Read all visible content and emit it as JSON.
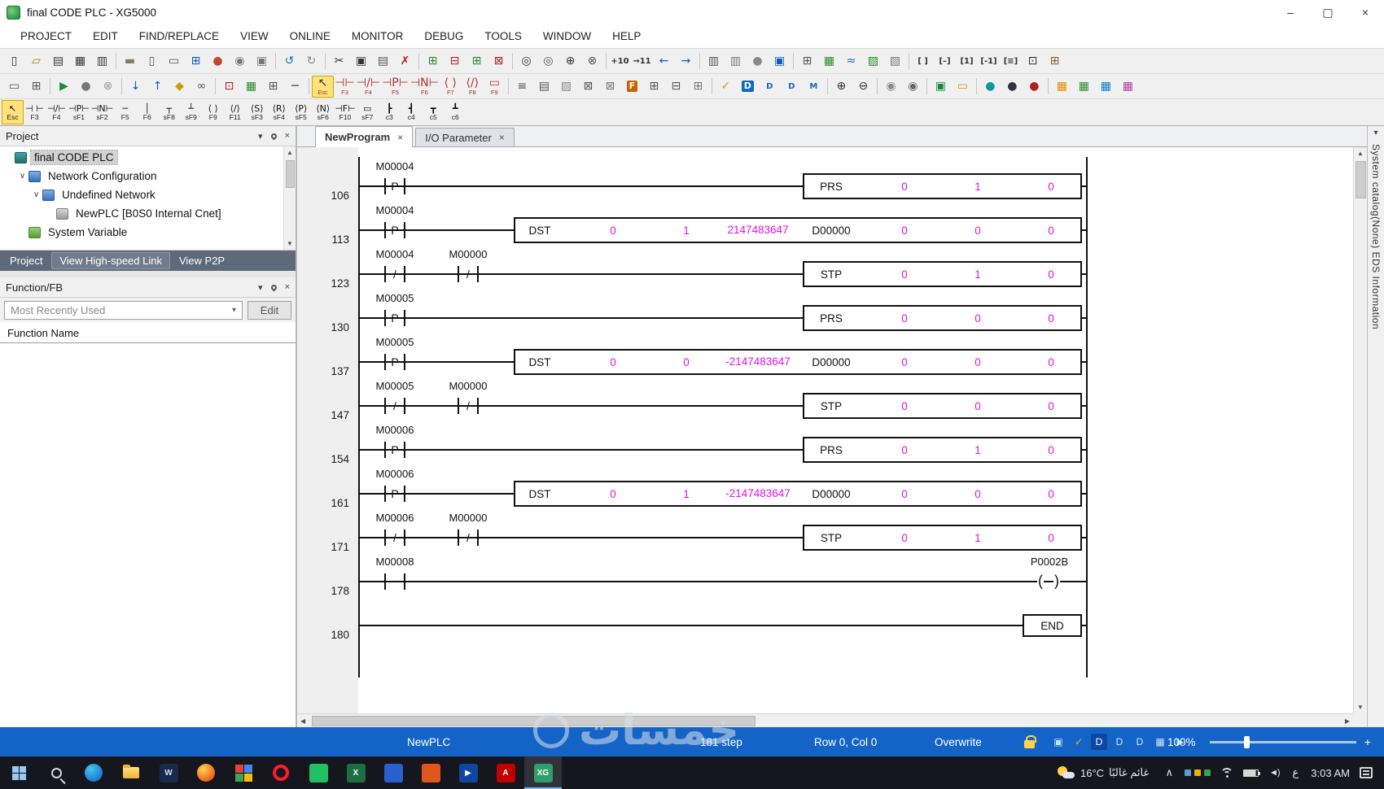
{
  "window": {
    "title": "final CODE PLC - XG5000",
    "controls": {
      "minimize": "–",
      "maximize": "▢",
      "close": "×"
    }
  },
  "glyphs": {
    "down": "▾",
    "expand": "∨",
    "scroll_up": "▲",
    "scroll_down": "▼",
    "scroll_left": "◀",
    "scroll_right": "▶"
  },
  "menu": {
    "items": [
      "PROJECT",
      "EDIT",
      "FIND/REPLACE",
      "VIEW",
      "ONLINE",
      "MONITOR",
      "DEBUG",
      "TOOLS",
      "WINDOW",
      "HELP"
    ]
  },
  "toolbar1": {
    "icons": [
      {
        "n": "new-file-icon",
        "g": "▯",
        "c": "#333"
      },
      {
        "n": "open-icon",
        "g": "▱",
        "c": "#a67c00"
      },
      {
        "n": "save-icon",
        "g": "▤",
        "c": "#333"
      },
      {
        "n": "save-all-icon",
        "g": "▦",
        "c": "#333"
      },
      {
        "n": "print-icon",
        "g": "▥",
        "c": "#333"
      },
      {
        "sep": true
      },
      {
        "n": "clipboard-icon",
        "g": "▬",
        "c": "#8a7a5a"
      },
      {
        "n": "print-preview-icon",
        "g": "▯",
        "c": "#555"
      },
      {
        "n": "page-setup-icon",
        "g": "▭",
        "c": "#555"
      },
      {
        "n": "grid-view-icon",
        "g": "⊞",
        "c": "#0a5ac8"
      },
      {
        "n": "monitor-ball-icon",
        "g": "●",
        "c": "#c04828"
      },
      {
        "n": "message-icon",
        "g": "◉",
        "c": "#777"
      },
      {
        "n": "capture-icon",
        "g": "▣",
        "c": "#777"
      },
      {
        "sep": true
      },
      {
        "n": "undo-icon",
        "g": "↺",
        "c": "#0a78b4"
      },
      {
        "n": "redo-icon",
        "g": "↻",
        "c": "#888"
      },
      {
        "sep": true
      },
      {
        "n": "cut-icon",
        "g": "✂",
        "c": "#333"
      },
      {
        "n": "copy-icon",
        "g": "▣",
        "c": "#333"
      },
      {
        "n": "paste-icon",
        "g": "▤",
        "c": "#555"
      },
      {
        "n": "delete-icon",
        "g": "✗",
        "c": "#c02020"
      },
      {
        "sep": true
      },
      {
        "n": "insert-line-icon",
        "g": "⊞",
        "c": "#2a8a2a"
      },
      {
        "n": "delete-line-icon",
        "g": "⊟",
        "c": "#c02020"
      },
      {
        "n": "insert-cell-icon",
        "g": "⊞",
        "c": "#2a8a2a"
      },
      {
        "n": "delete-cell-icon",
        "g": "⊠",
        "c": "#c02020"
      },
      {
        "sep": true
      },
      {
        "n": "find-icon",
        "g": "◎",
        "c": "#333"
      },
      {
        "n": "find-again-icon",
        "g": "◎",
        "c": "#555"
      },
      {
        "n": "replace-icon",
        "g": "⊕",
        "c": "#333"
      },
      {
        "n": "find-device-icon",
        "g": "⊗",
        "c": "#555"
      },
      {
        "sep": true
      },
      {
        "n": "goto-step-icon",
        "t": "+10",
        "c": "#333"
      },
      {
        "n": "goto-next-icon",
        "t": "→11",
        "c": "#333"
      },
      {
        "n": "back-icon",
        "g": "←",
        "c": "#0a5ac8"
      },
      {
        "n": "forward-icon",
        "g": "→",
        "c": "#0a5ac8"
      },
      {
        "sep": true
      },
      {
        "n": "print-ladder-icon",
        "g": "▥",
        "c": "#555"
      },
      {
        "n": "print-all-icon",
        "g": "▥",
        "c": "#777"
      },
      {
        "n": "user-icon",
        "g": "●",
        "c": "#888"
      },
      {
        "n": "options-icon",
        "g": "▣",
        "c": "#0a5ac8"
      },
      {
        "sep": true
      },
      {
        "n": "table-icon",
        "g": "⊞",
        "c": "#555"
      },
      {
        "n": "chart-icon",
        "g": "▦",
        "c": "#2a8a2a"
      },
      {
        "n": "trend-icon",
        "g": "≈",
        "c": "#0a78b4"
      },
      {
        "n": "graph-icon",
        "g": "▨",
        "c": "#2a8a2a"
      },
      {
        "n": "image-icon",
        "g": "▧",
        "c": "#777"
      },
      {
        "sep": true
      },
      {
        "n": "array-icon",
        "t": "[ ]",
        "c": "#333"
      },
      {
        "n": "array-minus-icon",
        "t": "[–]",
        "c": "#333"
      },
      {
        "n": "array-one-icon",
        "t": "[1]",
        "c": "#333"
      },
      {
        "n": "array-neg-icon",
        "t": "[-1]",
        "c": "#333"
      },
      {
        "n": "array-list-icon",
        "t": "[≡]",
        "c": "#333"
      },
      {
        "n": "struct-icon",
        "g": "⊡",
        "c": "#333"
      },
      {
        "n": "monitor-grid-icon",
        "g": "⊞",
        "c": "#965a28"
      }
    ]
  },
  "toolbar2": {
    "icons": [
      {
        "n": "window-icon",
        "g": "▭",
        "c": "#555"
      },
      {
        "n": "cascade-icon",
        "g": "⊞",
        "c": "#555"
      },
      {
        "sep": true
      },
      {
        "n": "run-icon",
        "g": "▶",
        "c": "#1a8a3a"
      },
      {
        "n": "pause-icon",
        "g": "●",
        "c": "#777"
      },
      {
        "n": "stop-icon",
        "g": "⊗",
        "c": "#999"
      },
      {
        "sep": true
      },
      {
        "n": "download-icon",
        "g": "↓",
        "c": "#0a5ac8"
      },
      {
        "n": "upload-icon",
        "g": "↑",
        "c": "#0a5ac8"
      },
      {
        "n": "key-icon",
        "g": "◆",
        "c": "#c8a000"
      },
      {
        "n": "link-icon",
        "g": "∞",
        "c": "#555"
      },
      {
        "sep": true
      },
      {
        "n": "online-edit-icon",
        "g": "⊡",
        "c": "#b02020"
      },
      {
        "n": "monitor-start-icon",
        "g": "▦",
        "c": "#2a8a2a"
      },
      {
        "n": "monitor-pause-icon",
        "g": "⊞",
        "c": "#555"
      },
      {
        "n": "hline-icon",
        "g": "─",
        "c": "#333"
      },
      {
        "sep": true
      },
      {
        "n": "select-tool",
        "g": "↖",
        "k": "Esc",
        "hl": true,
        "c": "#333"
      },
      {
        "n": "contact-tool",
        "g": "⊣⊢",
        "k": "F3",
        "c": "#b03030"
      },
      {
        "n": "nc-contact-tool",
        "g": "⊣/⊢",
        "k": "F4",
        "c": "#b03030"
      },
      {
        "n": "pulse-contact-tool",
        "g": "⊣P⊢",
        "k": "F5",
        "c": "#b03030"
      },
      {
        "n": "npulse-contact-tool",
        "g": "⊣N⊢",
        "k": "F6",
        "c": "#b03030"
      },
      {
        "n": "coil-tool",
        "g": "⟨ ⟩",
        "k": "F7",
        "c": "#b03030"
      },
      {
        "n": "nc-coil-tool",
        "g": "⟨/⟩",
        "k": "F8",
        "c": "#b03030"
      },
      {
        "n": "fb-tool",
        "g": "▭",
        "k": "F9",
        "c": "#b03030"
      },
      {
        "sep": true
      },
      {
        "n": "list-icon",
        "g": "≡",
        "c": "#555"
      },
      {
        "n": "comment-icon",
        "g": "▤",
        "c": "#555"
      },
      {
        "n": "image2-icon",
        "g": "▨",
        "c": "#888"
      },
      {
        "n": "cross-ref-icon",
        "g": "⊠",
        "c": "#555"
      },
      {
        "n": "used-device-icon",
        "g": "⊠",
        "c": "#777"
      },
      {
        "n": "font-icon",
        "t": "F",
        "c": "#fff",
        "bg": "#c86400"
      },
      {
        "n": "grid2-icon",
        "g": "⊞",
        "c": "#555"
      },
      {
        "n": "grid3-icon",
        "g": "⊟",
        "c": "#555"
      },
      {
        "n": "grid4-icon",
        "g": "⊞",
        "c": "#777"
      },
      {
        "sep": true
      },
      {
        "n": "check-program-icon",
        "g": "✓",
        "c": "#e88a00"
      },
      {
        "n": "device1-icon",
        "t": "D",
        "c": "#fff",
        "bg": "#1469be"
      },
      {
        "n": "device2-icon",
        "t": "D",
        "c": "#1469be"
      },
      {
        "n": "device3-icon",
        "t": "D",
        "c": "#1469be"
      },
      {
        "n": "memory-icon",
        "t": "M",
        "c": "#1469be"
      },
      {
        "sep": true
      },
      {
        "n": "zoom-in-icon",
        "g": "⊕",
        "c": "#333"
      },
      {
        "n": "zoom-out-icon",
        "g": "⊖",
        "c": "#333"
      },
      {
        "sep": true
      },
      {
        "n": "user1-icon",
        "g": "◉",
        "c": "#888"
      },
      {
        "n": "user2-icon",
        "g": "◉",
        "c": "#666"
      },
      {
        "sep": true
      },
      {
        "n": "screen-icon",
        "g": "▣",
        "c": "#1a8a3a"
      },
      {
        "n": "note-icon",
        "g": "▭",
        "c": "#c8a000"
      },
      {
        "sep": true
      },
      {
        "n": "circle1-icon",
        "g": "●",
        "c": "#0a9a9a"
      },
      {
        "n": "circle2-icon",
        "g": "●",
        "c": "#333344"
      },
      {
        "n": "circle3-icon",
        "g": "●",
        "c": "#b02020"
      },
      {
        "sep": true
      },
      {
        "n": "mod1-icon",
        "g": "▦",
        "c": "#e88a00"
      },
      {
        "n": "mod2-icon",
        "g": "▦",
        "c": "#2a8a2a"
      },
      {
        "n": "mod3-icon",
        "g": "▦",
        "c": "#0a78c8"
      },
      {
        "n": "mod4-icon",
        "g": "▦",
        "c": "#b23ab2"
      }
    ]
  },
  "ladder_tools": {
    "items": [
      {
        "s": "↖",
        "k": "Esc",
        "sel": true
      },
      {
        "s": "⊣ ⊢",
        "k": "F3"
      },
      {
        "s": "⊣/⊢",
        "k": "F4"
      },
      {
        "s": "⊣P⊢",
        "k": "sF1"
      },
      {
        "s": "⊣N⊢",
        "k": "sF2"
      },
      {
        "s": "─",
        "k": "F5"
      },
      {
        "s": "│",
        "k": "F6"
      },
      {
        "s": "┬",
        "k": "sF8"
      },
      {
        "s": "┴",
        "k": "sF9"
      },
      {
        "s": "⟨ ⟩",
        "k": "F9"
      },
      {
        "s": "⟨/⟩",
        "k": "F11"
      },
      {
        "s": "⟨S⟩",
        "k": "sF3"
      },
      {
        "s": "⟨R⟩",
        "k": "sF4"
      },
      {
        "s": "⟨P⟩",
        "k": "sF5"
      },
      {
        "s": "⟨N⟩",
        "k": "sF6"
      },
      {
        "s": "⊣F⊢",
        "k": "F10"
      },
      {
        "s": "▭",
        "k": "sF7"
      },
      {
        "s": "┣",
        "k": "c3"
      },
      {
        "s": "┫",
        "k": "c4"
      },
      {
        "s": "┳",
        "k": "c5"
      },
      {
        "s": "┻",
        "k": "c6"
      }
    ]
  },
  "panel_header_icons": [
    {
      "name": "collapse-icon",
      "glyph": "▾"
    },
    {
      "name": "pin-icon",
      "glyph": "pin"
    },
    {
      "name": "close-icon",
      "glyph": "×"
    }
  ],
  "project_panel": {
    "title": "Project",
    "tree": [
      {
        "label": "final CODE PLC",
        "level": 0,
        "selected": true,
        "icon": "plc",
        "expander": false
      },
      {
        "label": "Network Configuration",
        "level": 1,
        "icon": "network",
        "expander": true
      },
      {
        "label": "Undefined Network",
        "level": 2,
        "icon": "network",
        "expander": true
      },
      {
        "label": "NewPLC [B0S0 Internal Cnet]",
        "level": 3,
        "icon": "cnet",
        "expander": false
      },
      {
        "label": "System Variable",
        "level": 1,
        "icon": "sysvar",
        "expander": false
      }
    ],
    "tabs": [
      {
        "label": "Project",
        "raised": false
      },
      {
        "label": "View High-speed Link",
        "raised": true
      },
      {
        "label": "View P2P",
        "raised": false
      }
    ]
  },
  "function_panel": {
    "title": "Function/FB",
    "filter_value": "Most Recently Used",
    "edit_button": "Edit",
    "column_header": "Function Name"
  },
  "editor": {
    "close_glyph": "×",
    "tabs": [
      {
        "label": "NewProgram",
        "active": true
      },
      {
        "label": "I/O Parameter",
        "active": false
      }
    ],
    "rungs": [
      {
        "row": "106",
        "contacts": [
          {
            "label": "M00004",
            "mid": "P"
          }
        ],
        "block": {
          "size": "small",
          "name": "PRS",
          "vals": [
            "0",
            "1",
            "0"
          ]
        }
      },
      {
        "row": "113",
        "contacts": [
          {
            "label": "M00004",
            "mid": "P"
          }
        ],
        "block": {
          "size": "wide",
          "name": "DST",
          "vals": [
            "0",
            "1",
            "2147483647"
          ],
          "operand": "D00000",
          "vals2": [
            "0",
            "0",
            "0"
          ]
        }
      },
      {
        "row": "123",
        "contacts": [
          {
            "label": "M00004",
            "mid": "/"
          },
          {
            "label": "M00000",
            "mid": "/"
          }
        ],
        "block": {
          "size": "small",
          "name": "STP",
          "vals": [
            "0",
            "1",
            "0"
          ]
        }
      },
      {
        "row": "130",
        "contacts": [
          {
            "label": "M00005",
            "mid": "P"
          }
        ],
        "block": {
          "size": "small",
          "name": "PRS",
          "vals": [
            "0",
            "0",
            "0"
          ]
        }
      },
      {
        "row": "137",
        "contacts": [
          {
            "label": "M00005",
            "mid": "P"
          }
        ],
        "block": {
          "size": "wide",
          "name": "DST",
          "vals": [
            "0",
            "0",
            "-2147483647"
          ],
          "operand": "D00000",
          "vals2": [
            "0",
            "0",
            "0"
          ]
        }
      },
      {
        "row": "147",
        "contacts": [
          {
            "label": "M00005",
            "mid": "/"
          },
          {
            "label": "M00000",
            "mid": "/"
          }
        ],
        "block": {
          "size": "small",
          "name": "STP",
          "vals": [
            "0",
            "0",
            "0"
          ]
        }
      },
      {
        "row": "154",
        "contacts": [
          {
            "label": "M00006",
            "mid": "P"
          }
        ],
        "block": {
          "size": "small",
          "name": "PRS",
          "vals": [
            "0",
            "1",
            "0"
          ]
        }
      },
      {
        "row": "161",
        "contacts": [
          {
            "label": "M00006",
            "mid": "P"
          }
        ],
        "block": {
          "size": "wide",
          "name": "DST",
          "vals": [
            "0",
            "1",
            "-2147483647"
          ],
          "operand": "D00000",
          "vals2": [
            "0",
            "0",
            "0"
          ]
        }
      },
      {
        "row": "171",
        "contacts": [
          {
            "label": "M00006",
            "mid": "/"
          },
          {
            "label": "M00000",
            "mid": "/"
          }
        ],
        "block": {
          "size": "small",
          "name": "STP",
          "vals": [
            "0",
            "1",
            "0"
          ]
        }
      },
      {
        "row": "178",
        "contacts": [
          {
            "label": "M00008",
            "mid": ""
          }
        ],
        "coil": {
          "label": "P0002B"
        }
      },
      {
        "row": "180",
        "contacts": [],
        "end": "END"
      }
    ]
  },
  "right_strip": {
    "label": "System catalog(None) EDS Information"
  },
  "status_bar": {
    "plc": "NewPLC",
    "steps": "181 step",
    "cursor": "Row 0, Col 0",
    "mode": "Overwrite",
    "zoom": "100%",
    "plus": "+",
    "icons": [
      {
        "n": "monitor-status-icon",
        "g": "▣",
        "c": "#bfe3ff"
      },
      {
        "n": "check-status-icon",
        "g": "✓",
        "c": "#ffb300"
      },
      {
        "n": "device-status1-icon",
        "g": "D",
        "c": "#ffffff",
        "bg": "#0d47a1"
      },
      {
        "n": "device-status2-icon",
        "g": "D",
        "c": "#cfe3ff"
      },
      {
        "n": "device-status3-icon",
        "g": "D",
        "c": "#cfe3ff"
      },
      {
        "n": "grid-status-icon",
        "g": "▦",
        "c": "#cfe3ff"
      },
      {
        "n": "run-status-icon",
        "g": "▶",
        "c": "#9fd4ff"
      }
    ]
  },
  "taskbar": {
    "apps": [
      {
        "name": "start-button",
        "kind": "start"
      },
      {
        "name": "search-button",
        "kind": "search"
      },
      {
        "name": "edge-browser",
        "kind": "circle",
        "c1": "#45c6f0",
        "c2": "#0b5cc4"
      },
      {
        "name": "file-explorer",
        "kind": "folder"
      },
      {
        "name": "word-app",
        "kind": "square",
        "bg": "#1b2a4a",
        "t": "W",
        "tc": "#cfe0ff"
      },
      {
        "name": "firefox-browser",
        "kind": "circle",
        "c1": "#ffd24a",
        "c2": "#e3350d"
      },
      {
        "name": "photos-app",
        "kind": "multi"
      },
      {
        "name": "opera-browser",
        "kind": "ring",
        "c1": "#ff1b2d"
      },
      {
        "name": "green-app",
        "kind": "square",
        "bg": "#23c063",
        "t": "",
        "tc": "#fff"
      },
      {
        "name": "excel-app",
        "kind": "square",
        "bg": "#1d6f42",
        "t": "X",
        "tc": "#fff"
      },
      {
        "name": "blue-app",
        "kind": "square",
        "bg": "#2a5fd0",
        "t": "",
        "tc": "#fff"
      },
      {
        "name": "orange-app",
        "kind": "square",
        "bg": "#e0571a",
        "t": "",
        "tc": "#fff"
      },
      {
        "name": "media-app",
        "kind": "square",
        "bg": "#0d47a1",
        "t": "▶",
        "tc": "#fff"
      },
      {
        "name": "pdf-app",
        "kind": "square",
        "bg": "#c00000",
        "t": "A",
        "tc": "#fff"
      },
      {
        "name": "xg5000-app",
        "kind": "square",
        "bg": "#2e9e6b",
        "t": "XG",
        "tc": "#fff",
        "active": true
      }
    ],
    "multi_colors": [
      "#e8413c",
      "#4285f4",
      "#34a853",
      "#fbbc05"
    ],
    "weather_temp": "16°C",
    "weather_text": "غائم غالبًا",
    "tray_chevron": "∧",
    "tray_mini_colors": [
      "#5a9fd4",
      "#e8b400",
      "#3aa05a"
    ],
    "speaker_glyph": "◄)",
    "lang": "ع",
    "time": "3:03 AM"
  },
  "watermark": {
    "text": "خمسات"
  },
  "colors": {
    "status_blue": "#1464c8",
    "value_magenta": "#e012e0",
    "taskbar_dark": "#15161e",
    "tool_highlight": "#ffe27a"
  }
}
